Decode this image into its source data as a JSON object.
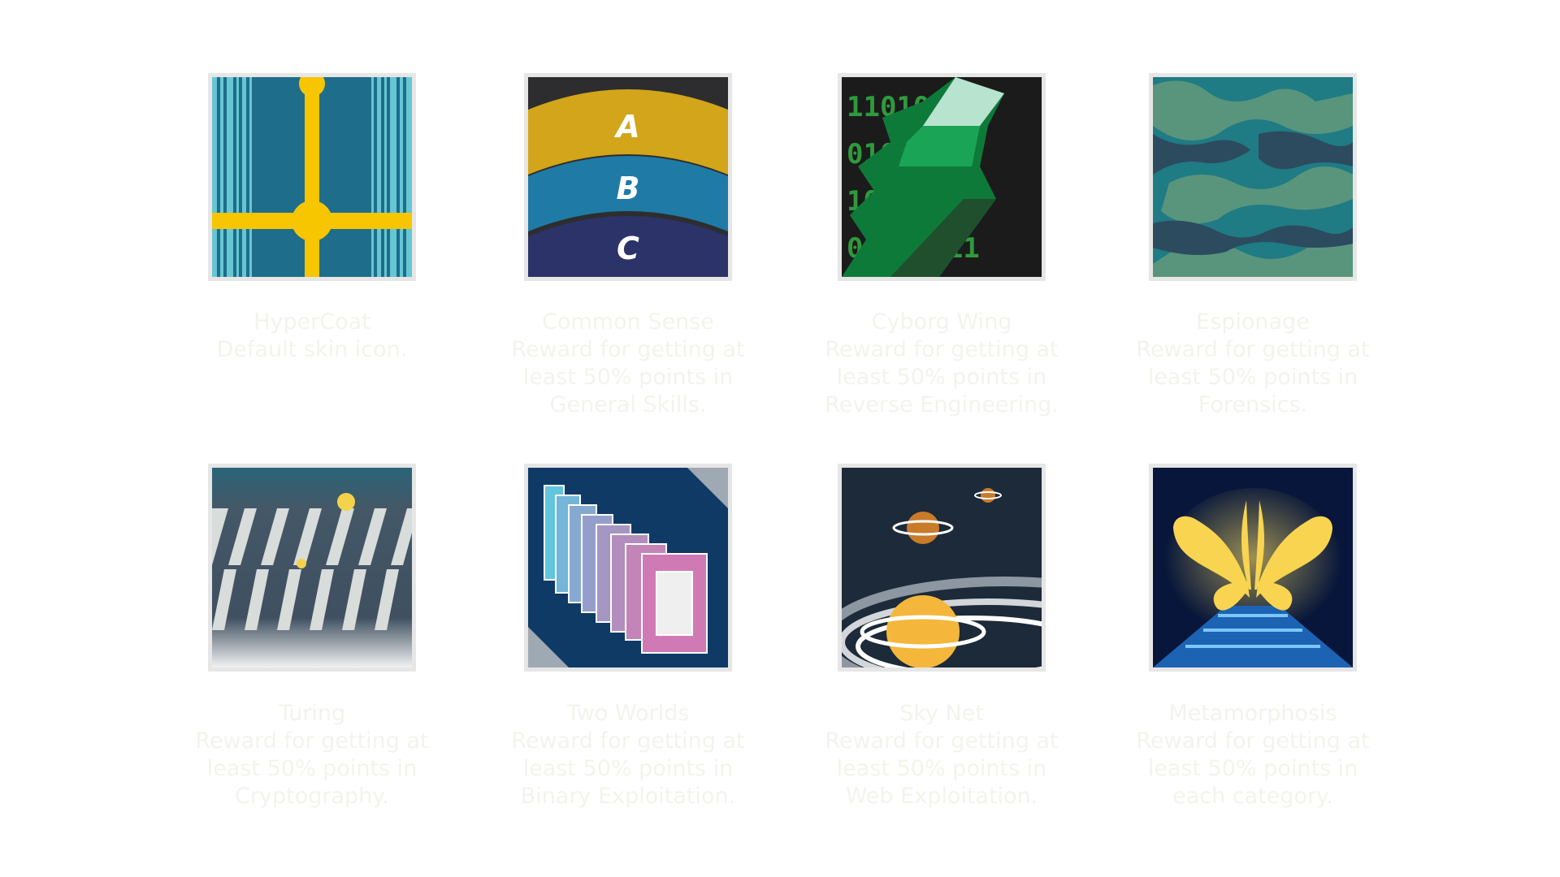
{
  "skins": [
    {
      "name": "HyperCoat",
      "description": "Default skin icon.",
      "icon": "hypercoat-icon"
    },
    {
      "name": "Common Sense",
      "description": "Reward for getting at least 50% points in General Skills.",
      "icon": "common-sense-icon",
      "letters": [
        "A",
        "B",
        "C"
      ]
    },
    {
      "name": "Cyborg Wing",
      "description": "Reward for getting at least 50% points in Reverse Engineering.",
      "icon": "cyborg-wing-icon",
      "binary": [
        "11010010",
        "01011110",
        "10100101",
        "01101111"
      ]
    },
    {
      "name": "Espionage",
      "description": "Reward for getting at least 50% points in Forensics.",
      "icon": "espionage-icon"
    },
    {
      "name": "Turing",
      "description": "Reward for getting at least 50% points in Cryptography.",
      "icon": "turing-icon"
    },
    {
      "name": "Two Worlds",
      "description": "Reward for getting at least 50% points in Binary Exploitation.",
      "icon": "two-worlds-icon"
    },
    {
      "name": "Sky Net",
      "description": "Reward for getting at least 50% points in Web Exploitation.",
      "icon": "sky-net-icon"
    },
    {
      "name": "Metamorphosis",
      "description": "Reward for getting at least 50% points in each category.",
      "icon": "metamorphosis-icon"
    }
  ],
  "colors": {
    "tile_border": "#e6e6e6",
    "caption_text": "#f3f3ee",
    "yellow": "#f7c600",
    "teal": "#1d6b8a"
  }
}
